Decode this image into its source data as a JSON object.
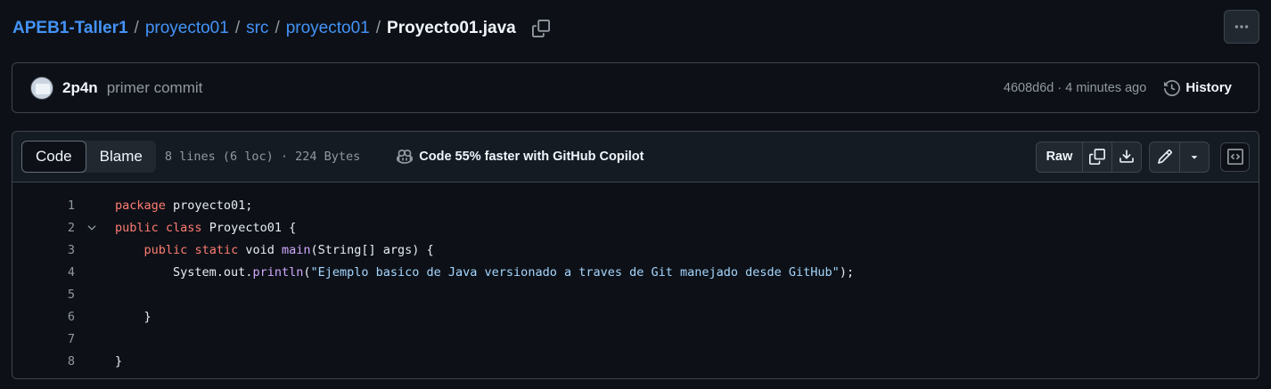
{
  "breadcrumb": {
    "repo": "APEB1-Taller1",
    "separator": "/",
    "parts": [
      "proyecto01",
      "src",
      "proyecto01"
    ],
    "file": "Proyecto01.java"
  },
  "commit": {
    "author": "2p4n",
    "message": "primer commit",
    "meta": "4608d6d · 4 minutes ago",
    "history_label": "History"
  },
  "file_header": {
    "tabs": [
      "Code",
      "Blame"
    ],
    "active_tab": "Code",
    "info": "8 lines (6 loc) · 224 Bytes",
    "copilot": "Code 55% faster with GitHub Copilot",
    "raw_label": "Raw"
  },
  "code": {
    "line_numbers": [
      "1",
      "2",
      "3",
      "4",
      "5",
      "6",
      "7",
      "8"
    ],
    "lines": [
      [
        {
          "t": "package",
          "c": "kw"
        },
        {
          "t": " proyecto01;",
          "c": ""
        }
      ],
      [
        {
          "t": "public",
          "c": "kw"
        },
        {
          "t": " ",
          "c": ""
        },
        {
          "t": "class",
          "c": "kw"
        },
        {
          "t": " Proyecto01 {",
          "c": ""
        }
      ],
      [
        {
          "t": "    ",
          "c": ""
        },
        {
          "t": "public",
          "c": "kw"
        },
        {
          "t": " ",
          "c": ""
        },
        {
          "t": "static",
          "c": "kw"
        },
        {
          "t": " void ",
          "c": ""
        },
        {
          "t": "main",
          "c": "fn"
        },
        {
          "t": "(String[] args) {",
          "c": ""
        }
      ],
      [
        {
          "t": "        System.out.",
          "c": ""
        },
        {
          "t": "println",
          "c": "fn"
        },
        {
          "t": "(",
          "c": ""
        },
        {
          "t": "\"Ejemplo basico de Java versionado a traves de Git manejado desde GitHub\"",
          "c": "str"
        },
        {
          "t": ");",
          "c": ""
        }
      ],
      [],
      [
        {
          "t": "    }",
          "c": ""
        }
      ],
      [],
      [
        {
          "t": "}",
          "c": ""
        }
      ]
    ]
  },
  "colors": {
    "background": "#0d1117",
    "link": "#4493f8",
    "keyword": "#ff7b72",
    "function": "#d2a8ff",
    "string": "#a5d6ff"
  }
}
